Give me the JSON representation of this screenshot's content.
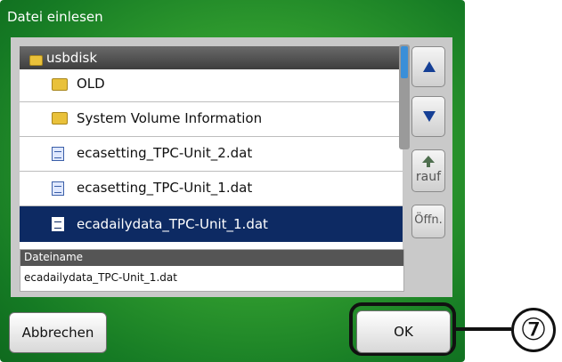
{
  "dialog": {
    "title": "Datei einlesen"
  },
  "file_list": {
    "current_folder": "usbdisk",
    "items": [
      {
        "type": "folder",
        "name": "OLD"
      },
      {
        "type": "folder",
        "name": "System Volume Information"
      },
      {
        "type": "file",
        "name": "ecasetting_TPC-Unit_2.dat"
      },
      {
        "type": "file",
        "name": "ecasetting_TPC-Unit_1.dat"
      },
      {
        "type": "file",
        "name": "ecadailydata_TPC-Unit_1.dat",
        "selected": true
      }
    ]
  },
  "side_buttons": {
    "up_icon": "triangle-up-icon",
    "down_icon": "triangle-down-icon",
    "rauf_label": "rauf",
    "open_label": "Öffn."
  },
  "filename": {
    "label": "Dateiname",
    "value": "ecadailydata_TPC-Unit_1.dat"
  },
  "buttons": {
    "cancel_label": "Abbrechen",
    "ok_label": "OK"
  },
  "annotation": {
    "callout_number": "⑦"
  },
  "colors": {
    "selection": "#0d2a63",
    "accent_arrow": "#153f95",
    "background_green": "#2f9a2e"
  }
}
